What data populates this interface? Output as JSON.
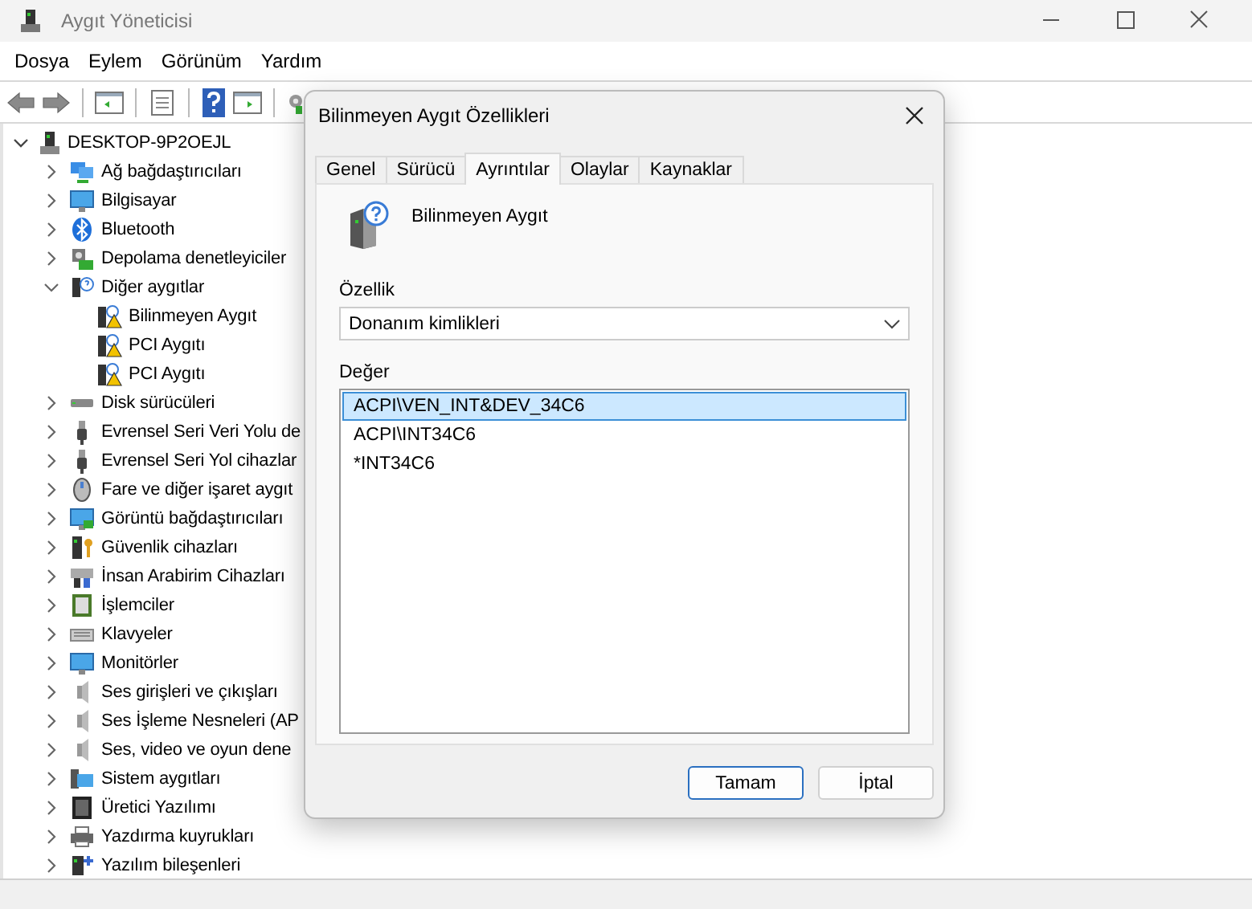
{
  "window": {
    "title": "Aygıt Yöneticisi"
  },
  "menu": [
    "Dosya",
    "Eylem",
    "Görünüm",
    "Yardım"
  ],
  "tree": {
    "label": "DESKTOP-9P2OEJL",
    "expanded": true,
    "children": [
      {
        "label": "Ağ bağdaştırıcıları",
        "expanded": false
      },
      {
        "label": "Bilgisayar",
        "expanded": false
      },
      {
        "label": "Bluetooth",
        "expanded": false
      },
      {
        "label": "Depolama denetleyiciler",
        "expanded": false
      },
      {
        "label": "Diğer aygıtlar",
        "expanded": true,
        "children": [
          {
            "label": "Bilinmeyen Aygıt",
            "warning": true
          },
          {
            "label": "PCI Aygıtı",
            "warning": true
          },
          {
            "label": "PCI Aygıtı",
            "warning": true
          }
        ]
      },
      {
        "label": "Disk sürücüleri",
        "expanded": false
      },
      {
        "label": "Evrensel Seri Veri Yolu de",
        "expanded": false
      },
      {
        "label": "Evrensel Seri Yol cihazlar",
        "expanded": false
      },
      {
        "label": "Fare ve diğer işaret aygıt",
        "expanded": false
      },
      {
        "label": "Görüntü bağdaştırıcıları",
        "expanded": false
      },
      {
        "label": "Güvenlik cihazları",
        "expanded": false
      },
      {
        "label": "İnsan Arabirim Cihazları",
        "expanded": false
      },
      {
        "label": "İşlemciler",
        "expanded": false
      },
      {
        "label": "Klavyeler",
        "expanded": false
      },
      {
        "label": "Monitörler",
        "expanded": false
      },
      {
        "label": "Ses girişleri ve çıkışları",
        "expanded": false
      },
      {
        "label": "Ses İşleme Nesneleri (AP",
        "expanded": false
      },
      {
        "label": "Ses, video ve oyun dene",
        "expanded": false
      },
      {
        "label": "Sistem aygıtları",
        "expanded": false
      },
      {
        "label": "Üretici Yazılımı",
        "expanded": false
      },
      {
        "label": "Yazdırma kuyrukları",
        "expanded": false
      },
      {
        "label": "Yazılım bileşenleri",
        "expanded": false
      }
    ]
  },
  "dialog": {
    "title": "Bilinmeyen Aygıt Özellikleri",
    "tabs": [
      {
        "label": "Genel",
        "selected": false
      },
      {
        "label": "Sürücü",
        "selected": false
      },
      {
        "label": "Ayrıntılar",
        "selected": true
      },
      {
        "label": "Olaylar",
        "selected": false
      },
      {
        "label": "Kaynaklar",
        "selected": false
      }
    ],
    "device_name": "Bilinmeyen Aygıt",
    "property_label": "Özellik",
    "property_value": "Donanım kimlikleri",
    "value_label": "Değer",
    "values": [
      {
        "text": "ACPI\\VEN_INT&DEV_34C6",
        "selected": true
      },
      {
        "text": "ACPI\\INT34C6",
        "selected": false
      },
      {
        "text": "*INT34C6",
        "selected": false
      }
    ],
    "buttons": [
      {
        "label": "Tamam",
        "default": true
      },
      {
        "label": "İptal",
        "default": false
      }
    ]
  }
}
